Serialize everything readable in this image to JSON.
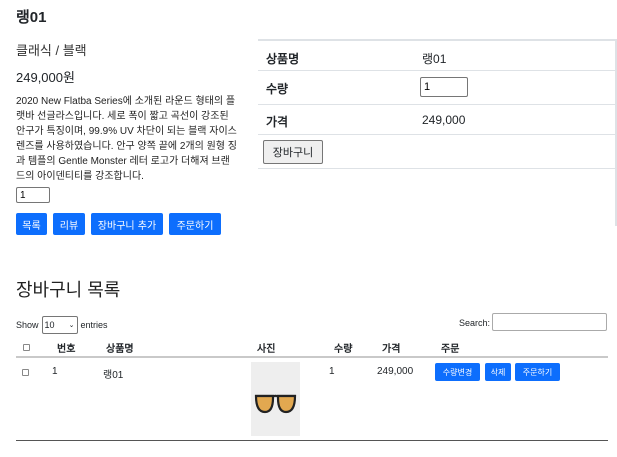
{
  "product": {
    "title": "랭01",
    "subtitle": "클래식 / 블랙",
    "price": "249,000원",
    "description": "2020 New Flatba Series에 소개된 라운드 형태의 플랫바 선글라스입니다. 세로 폭이 짧고 곡선이 강조된 안구가 특징이며, 99.9% UV 차단이 되는 블랙 자이스 렌즈를 사용하였습니다. 안구 양쪽 끝에 2개의 원형 징과 템플의 Gentle Monster 레터 로고가 더해져 브랜드의 아이덴티티를 강조합니다.",
    "quantity": "1",
    "buttons": {
      "list": "목록",
      "review": "리뷰",
      "add_cart": "장바구니 추가",
      "order": "주문하기"
    }
  },
  "summary": {
    "name_label": "상품명",
    "name_value": "랭01",
    "qty_label": "수량",
    "qty_value": "1",
    "price_label": "가격",
    "price_value": "249,000",
    "cart_button": "장바구니"
  },
  "cart": {
    "title": "장바구니 목록",
    "show_label": "Show",
    "page_length": "10",
    "entries_label": "entries",
    "search_label": "Search:",
    "columns": {
      "number": "번호",
      "name": "상품명",
      "photo": "사진",
      "qty": "수량",
      "price": "가격",
      "order": "주문"
    },
    "rows": [
      {
        "number": "1",
        "name": "랭01",
        "image": "sunglasses-icon",
        "qty": "1",
        "price": "249,000",
        "actions": {
          "change_qty": "수량변경",
          "delete": "삭제",
          "order": "주문하기"
        }
      }
    ]
  },
  "colors": {
    "primary": "#0d6efd",
    "border": "#dee2e6"
  }
}
